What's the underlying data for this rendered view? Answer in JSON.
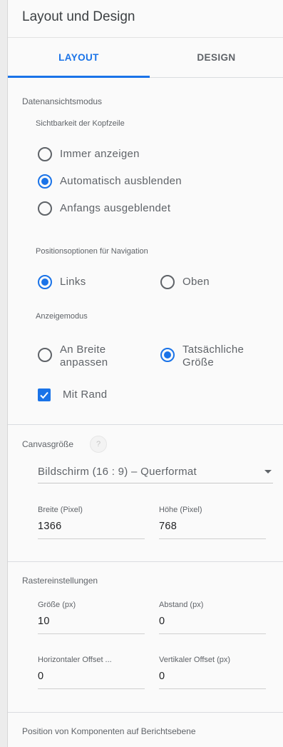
{
  "header": {
    "title": "Layout und Design"
  },
  "tabs": [
    {
      "label": "LAYOUT"
    },
    {
      "label": "DESIGN"
    }
  ],
  "data_view": {
    "title": "Datenansichtsmodus",
    "header_visibility": {
      "label": "Sichtbarkeit der Kopfzeile",
      "options": [
        "Immer anzeigen",
        "Automatisch ausblenden",
        "Anfangs ausgeblendet"
      ],
      "selected": "Automatisch ausblenden"
    },
    "nav_position": {
      "label": "Positionsoptionen für Navigation",
      "options": [
        "Links",
        "Oben"
      ],
      "selected": "Links"
    },
    "display_mode": {
      "label": "Anzeigemodus",
      "options": [
        "An Breite anpassen",
        "Tatsächliche Größe"
      ],
      "selected": "Tatsächliche Größe"
    },
    "border_checkbox": {
      "label": "Mit Rand",
      "checked": true
    }
  },
  "canvas": {
    "title": "Canvasgröße",
    "help": "?",
    "size_select": "Bildschirm (16 : 9) – Querformat",
    "width": {
      "label": "Breite (Pixel)",
      "value": "1366"
    },
    "height": {
      "label": "Höhe (Pixel)",
      "value": "768"
    }
  },
  "grid": {
    "title": "Rastereinstellungen",
    "size": {
      "label": "Größe (px)",
      "value": "10"
    },
    "spacing": {
      "label": "Abstand (px)",
      "value": "0"
    },
    "h_offset": {
      "label": "Horizontaler Offset ...",
      "value": "0"
    },
    "v_offset": {
      "label": "Vertikaler Offset (px)",
      "value": "0"
    }
  },
  "report_level": {
    "title": "Position von Komponenten auf Berichtsebene"
  },
  "colors": {
    "accent": "#1a73e8",
    "text": "#5f6368",
    "divider": "#dadce0"
  },
  "icons": [
    "help-icon",
    "dropdown-arrow-icon",
    "check-icon"
  ]
}
